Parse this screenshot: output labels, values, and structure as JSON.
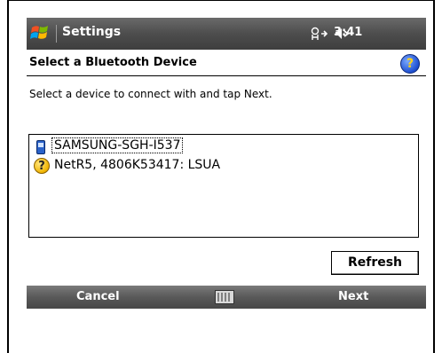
{
  "titlebar": {
    "title": "Settings",
    "time": "3:41",
    "icons": [
      "windows-start-icon",
      "connectivity-icon",
      "volume-icon"
    ]
  },
  "header": {
    "title": "Select a Bluetooth Device",
    "help_icon": "help-icon",
    "help_glyph": "?"
  },
  "instructions": "Select a device to connect with and tap Next.",
  "devices": [
    {
      "label": "SAMSUNG-SGH-I537",
      "icon": "phone-icon",
      "selected": true
    },
    {
      "label": "NetR5, 4806K53417: LSUA",
      "icon": "unknown-device-icon",
      "selected": false
    }
  ],
  "unknown_glyph": "?",
  "refresh_label": "Refresh",
  "softkeys": {
    "left": "Cancel",
    "right": "Next",
    "center_icon": "keyboard-icon"
  },
  "colors": {
    "bar_gray": "#4d4d4d",
    "help_blue": "#1e4fd0",
    "unknown_yellow": "#f0b400"
  }
}
